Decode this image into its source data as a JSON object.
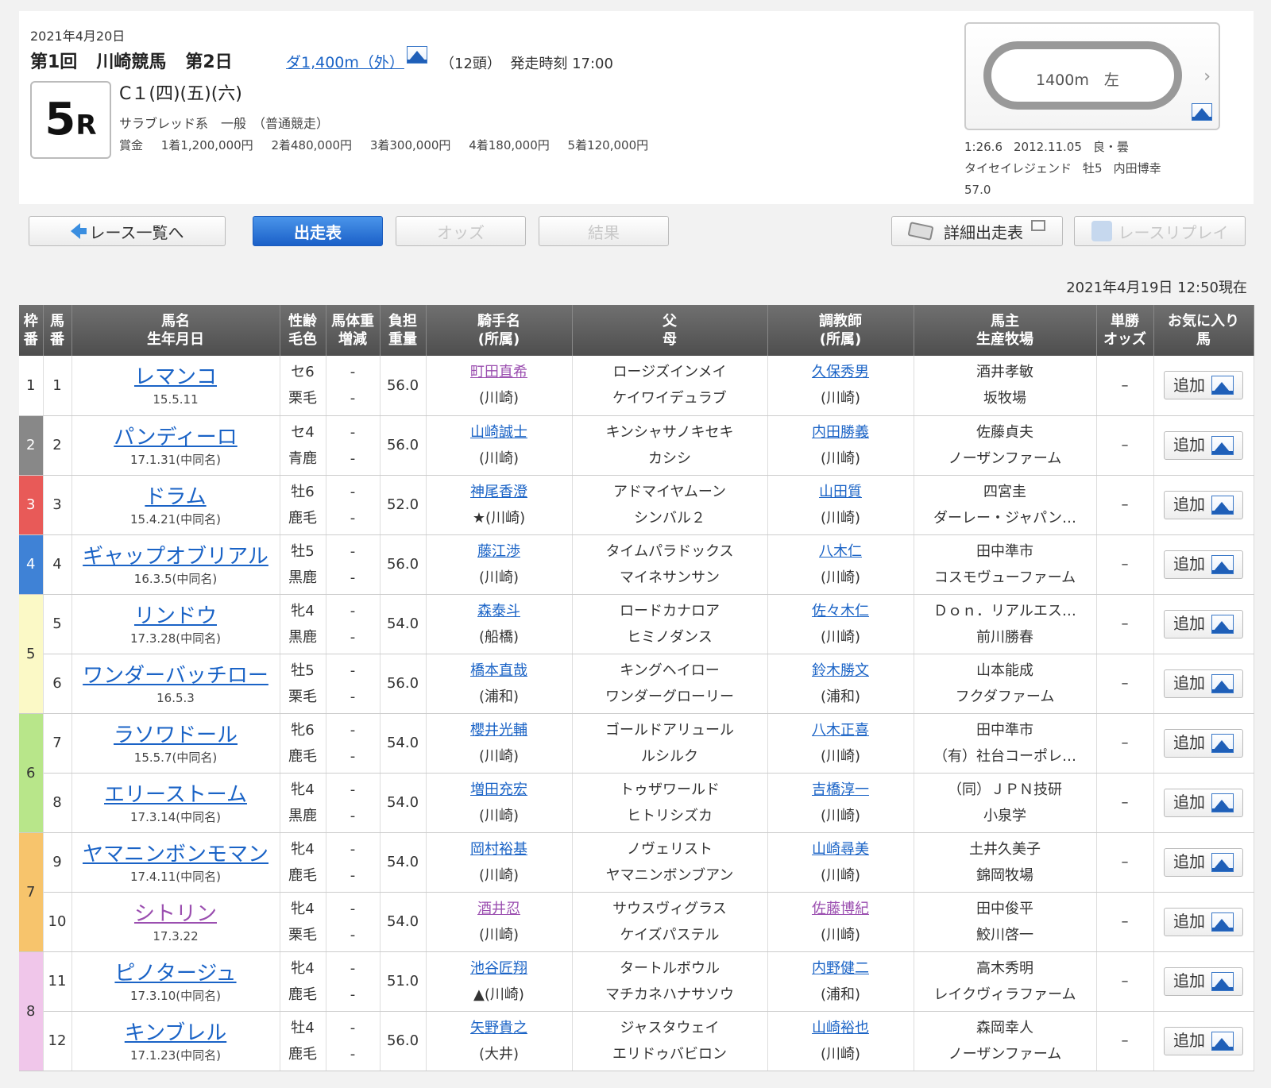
{
  "header": {
    "date": "2021年4月20日",
    "meet": [
      "第1回",
      "川崎競馬",
      "第2日"
    ],
    "distance": "ダ1,400m（外）",
    "runners": "（12頭）",
    "post_time": "発走時刻 17:00",
    "race_number": "5",
    "race_suffix": "R",
    "race_class": "C１(四)(五)(六)",
    "race_type": "サラブレッド系　一般　（普通競走）",
    "prize_label": "賞金",
    "prizes": [
      "1着1,200,000円",
      "2着480,000円",
      "3着300,000円",
      "4着180,000円",
      "5着120,000円"
    ]
  },
  "course": {
    "label": "1400m　左",
    "record_time": "1:26.6",
    "record_date": "2012.11.05",
    "record_condition": "良・曇",
    "record_horse": "タイセイレジェンド",
    "record_sex_age": "牡5",
    "record_jockey": "内田博幸",
    "record_weight": "57.0"
  },
  "tabs": {
    "race_list": "レース一覧へ",
    "entries": "出走表",
    "odds": "オッズ",
    "results": "結果",
    "detail": "詳細出走表",
    "replay": "レースリプレイ"
  },
  "as_of": "2021年4月19日 12:50現在",
  "columns": {
    "frame": [
      "枠",
      "番"
    ],
    "number": [
      "馬",
      "番"
    ],
    "horse": [
      "馬名",
      "生年月日"
    ],
    "sex": [
      "性齢",
      "毛色"
    ],
    "weight": [
      "馬体重",
      "増減"
    ],
    "burden": [
      "負担",
      "重量"
    ],
    "jockey": [
      "騎手名",
      "(所属)"
    ],
    "parents": [
      "父",
      "母"
    ],
    "trainer": [
      "調教師",
      "(所属)"
    ],
    "owner": [
      "馬主",
      "生産牧場"
    ],
    "odds": [
      "単勝",
      "オッズ"
    ],
    "fav": [
      "お気に入り",
      "馬"
    ]
  },
  "add_label": "追加",
  "frames": [
    {
      "number": "1",
      "color": "#ffffff",
      "text_color": "#333333",
      "rows": 1
    },
    {
      "number": "2",
      "color": "#888888",
      "text_color": "#ffffff",
      "rows": 1
    },
    {
      "number": "3",
      "color": "#e85a58",
      "text_color": "#ffffff",
      "rows": 1
    },
    {
      "number": "4",
      "color": "#3f82d6",
      "text_color": "#ffffff",
      "rows": 1
    },
    {
      "number": "5",
      "color": "#fbf9c6",
      "text_color": "#333333",
      "rows": 2
    },
    {
      "number": "6",
      "color": "#b8e68a",
      "text_color": "#333333",
      "rows": 2
    },
    {
      "number": "7",
      "color": "#f7c46c",
      "text_color": "#333333",
      "rows": 2
    },
    {
      "number": "8",
      "color": "#f0c6ea",
      "text_color": "#333333",
      "rows": 2
    }
  ],
  "horses": [
    {
      "num": "1",
      "name": "レマンコ",
      "birth": "15.5.11",
      "sex": "セ6",
      "coat": "栗毛",
      "wt": "-",
      "wt_diff": "-",
      "burden": "56.0",
      "jockey": "町田直希",
      "jockey_mark": "",
      "jockey_aff": "(川崎)",
      "sire": "ロージズインメイ",
      "dam": "ケイワイデュラブ",
      "trainer": "久保秀男",
      "trainer_aff": "(川崎)",
      "owner": "酒井孝敏",
      "breeder": "坂牧場",
      "odds": "–"
    },
    {
      "num": "2",
      "name": "パンディーロ",
      "birth": "17.1.31(中同名)",
      "sex": "セ4",
      "coat": "青鹿",
      "wt": "-",
      "wt_diff": "-",
      "burden": "56.0",
      "jockey": "山崎誠士",
      "jockey_mark": "",
      "jockey_aff": "(川崎)",
      "sire": "キンシャサノキセキ",
      "dam": "カシシ",
      "trainer": "内田勝義",
      "trainer_aff": "(川崎)",
      "owner": "佐藤貞夫",
      "breeder": "ノーザンファーム",
      "odds": "–"
    },
    {
      "num": "3",
      "name": "ドラム",
      "birth": "15.4.21(中同名)",
      "sex": "牡6",
      "coat": "鹿毛",
      "wt": "-",
      "wt_diff": "-",
      "burden": "52.0",
      "jockey": "神尾香澄",
      "jockey_mark": "★",
      "jockey_aff": "(川崎)",
      "sire": "アドマイヤムーン",
      "dam": "シンバル２",
      "trainer": "山田質",
      "trainer_aff": "(川崎)",
      "owner": "四宮圭",
      "breeder": "ダーレー・ジャパン…",
      "odds": "–"
    },
    {
      "num": "4",
      "name": "ギャップオブリアル",
      "birth": "16.3.5(中同名)",
      "sex": "牡5",
      "coat": "黒鹿",
      "wt": "-",
      "wt_diff": "-",
      "burden": "56.0",
      "jockey": "藤江渉",
      "jockey_mark": "",
      "jockey_aff": "(川崎)",
      "sire": "タイムパラドックス",
      "dam": "マイネサンサン",
      "trainer": "八木仁",
      "trainer_aff": "(川崎)",
      "owner": "田中準市",
      "breeder": "コスモヴューファーム",
      "odds": "–"
    },
    {
      "num": "5",
      "name": "リンドウ",
      "birth": "17.3.28(中同名)",
      "sex": "牝4",
      "coat": "黒鹿",
      "wt": "-",
      "wt_diff": "-",
      "burden": "54.0",
      "jockey": "森泰斗",
      "jockey_mark": "",
      "jockey_aff": "(船橋)",
      "sire": "ロードカナロア",
      "dam": "ヒミノダンス",
      "trainer": "佐々木仁",
      "trainer_aff": "(川崎)",
      "owner": "Ｄｏｎ．リアルエス…",
      "breeder": "前川勝春",
      "odds": "–"
    },
    {
      "num": "6",
      "name": "ワンダーバッチロー",
      "birth": "16.5.3",
      "sex": "牡5",
      "coat": "栗毛",
      "wt": "-",
      "wt_diff": "-",
      "burden": "56.0",
      "jockey": "橋本直哉",
      "jockey_mark": "",
      "jockey_aff": "(浦和)",
      "sire": "キングヘイロー",
      "dam": "ワンダーグローリー",
      "trainer": "鈴木勝文",
      "trainer_aff": "(浦和)",
      "owner": "山本能成",
      "breeder": "フクダファーム",
      "odds": "–"
    },
    {
      "num": "7",
      "name": "ラソワドール",
      "birth": "15.5.7(中同名)",
      "sex": "牝6",
      "coat": "鹿毛",
      "wt": "-",
      "wt_diff": "-",
      "burden": "54.0",
      "jockey": "櫻井光輔",
      "jockey_mark": "",
      "jockey_aff": "(川崎)",
      "sire": "ゴールドアリュール",
      "dam": "ルシルク",
      "trainer": "八木正喜",
      "trainer_aff": "(川崎)",
      "owner": "田中準市",
      "breeder": "（有）社台コーポレ…",
      "odds": "–"
    },
    {
      "num": "8",
      "name": "エリーストーム",
      "birth": "17.3.14(中同名)",
      "sex": "牝4",
      "coat": "黒鹿",
      "wt": "-",
      "wt_diff": "-",
      "burden": "54.0",
      "jockey": "増田充宏",
      "jockey_mark": "",
      "jockey_aff": "(川崎)",
      "sire": "トゥザワールド",
      "dam": "ヒトリシズカ",
      "trainer": "吉橋淳一",
      "trainer_aff": "(川崎)",
      "owner": "（同）ＪＰＮ技研",
      "breeder": "小泉学",
      "odds": "–"
    },
    {
      "num": "9",
      "name": "ヤマニンボンモマン",
      "birth": "17.4.11(中同名)",
      "sex": "牝4",
      "coat": "鹿毛",
      "wt": "-",
      "wt_diff": "-",
      "burden": "54.0",
      "jockey": "岡村裕基",
      "jockey_mark": "",
      "jockey_aff": "(川崎)",
      "sire": "ノヴェリスト",
      "dam": "ヤマニンボンブアン",
      "trainer": "山崎尋美",
      "trainer_aff": "(川崎)",
      "owner": "土井久美子",
      "breeder": "錦岡牧場",
      "odds": "–"
    },
    {
      "num": "10",
      "name": "シトリン",
      "birth": "17.3.22",
      "sex": "牝4",
      "coat": "栗毛",
      "wt": "-",
      "wt_diff": "-",
      "burden": "54.0",
      "jockey": "酒井忍",
      "jockey_mark": "",
      "jockey_aff": "(川崎)",
      "sire": "サウスヴィグラス",
      "dam": "ケイズパステル",
      "trainer": "佐藤博紀",
      "trainer_aff": "(川崎)",
      "owner": "田中俊平",
      "breeder": "鮫川啓一",
      "odds": "–"
    },
    {
      "num": "11",
      "name": "ピノタージュ",
      "birth": "17.3.10(中同名)",
      "sex": "牝4",
      "coat": "鹿毛",
      "wt": "-",
      "wt_diff": "-",
      "burden": "51.0",
      "jockey": "池谷匠翔",
      "jockey_mark": "▲",
      "jockey_aff": "(川崎)",
      "sire": "タートルボウル",
      "dam": "マチカネハナサソウ",
      "trainer": "内野健二",
      "trainer_aff": "(浦和)",
      "owner": "高木秀明",
      "breeder": "レイクヴィラファーム",
      "odds": "–"
    },
    {
      "num": "12",
      "name": "キンブレル",
      "birth": "17.1.23(中同名)",
      "sex": "牡4",
      "coat": "鹿毛",
      "wt": "-",
      "wt_diff": "-",
      "burden": "56.0",
      "jockey": "矢野貴之",
      "jockey_mark": "",
      "jockey_aff": "(大井)",
      "sire": "ジャスタウェイ",
      "dam": "エリドゥバビロン",
      "trainer": "山崎裕也",
      "trainer_aff": "(川崎)",
      "owner": "森岡幸人",
      "breeder": "ノーザンファーム",
      "odds": "–"
    }
  ],
  "visited": {
    "horses": [
      "10"
    ],
    "jockeys": [
      "1",
      "10"
    ],
    "trainers": [
      "10"
    ]
  }
}
